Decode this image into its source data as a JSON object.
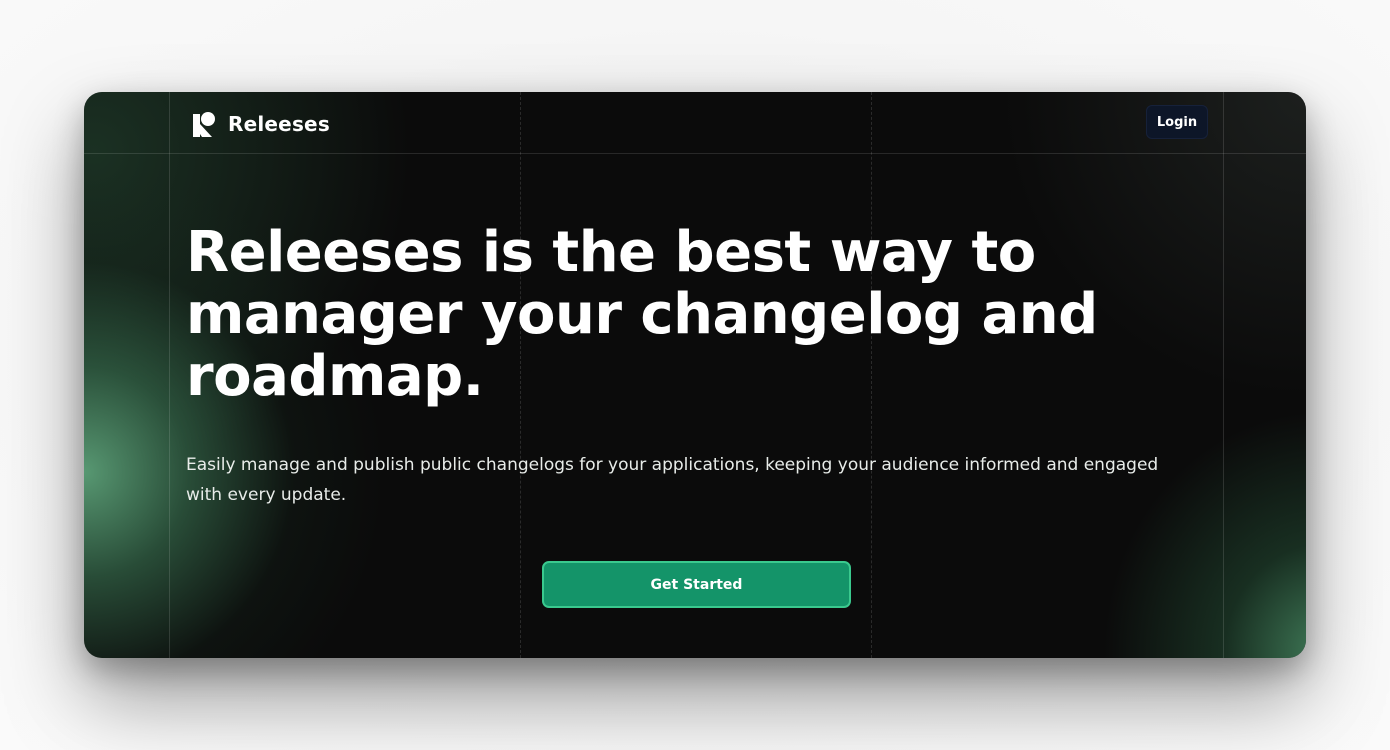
{
  "header": {
    "brand_name": "Releeses",
    "brand_icon": "releeses-logo-icon",
    "login_label": "Login"
  },
  "hero": {
    "headline": "Releeses is the best way to manager your changelog and roadmap.",
    "subheadline": "Easily manage and publish public changelogs for your applications, keeping your audience informed and engaged with every update.",
    "cta_label": "Get Started"
  },
  "colors": {
    "background": "#0b0b0b",
    "accent": "#149469",
    "accent_border": "#3ac98e",
    "login_bg": "#0d1628",
    "glow": "#5ca078"
  }
}
